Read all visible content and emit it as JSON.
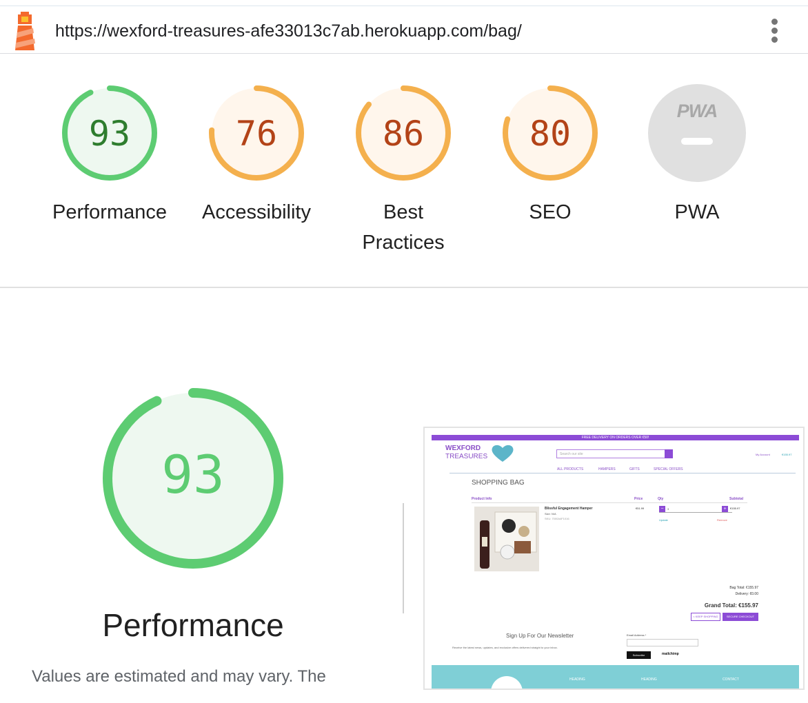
{
  "header": {
    "url": "https://wexford-treasures-afe33013c7ab.herokuapp.com/bag/",
    "logo_icon": "lighthouse-icon",
    "menu_icon": "more-vert-icon"
  },
  "gauges": [
    {
      "label": "Performance",
      "score": "93",
      "value": 93,
      "color": "#5dcc72",
      "text_color": "#2e7d2e",
      "fill": "#eef8f0"
    },
    {
      "label": "Accessibility",
      "score": "76",
      "value": 76,
      "color": "#f4b04d",
      "text_color": "#b34317",
      "fill": "#fff6ec"
    },
    {
      "label": "Best Practices",
      "label_line1": "Best",
      "label_line2": "Practices",
      "score": "86",
      "value": 86,
      "color": "#f4b04d",
      "text_color": "#b34317",
      "fill": "#fff6ec"
    },
    {
      "label": "SEO",
      "score": "80",
      "value": 80,
      "color": "#f4b04d",
      "text_color": "#b34317",
      "fill": "#fff6ec"
    },
    {
      "label": "PWA",
      "badge_text": "PWA",
      "color": "#e0e0e0"
    }
  ],
  "main": {
    "score": "93",
    "value": 93,
    "title": "Performance",
    "description": "Values are estimated and may vary. The"
  },
  "thumbnail": {
    "banner": "FREE DELIVERY ON ORDERS OVER €50!",
    "logo_line1": "WEXFORD",
    "logo_line2": "TREASURES",
    "search_placeholder": "Search our site",
    "account": "My Account",
    "bag_total": "€155.97",
    "nav": [
      "ALL PRODUCTS",
      "HAMPERS",
      "GIFTS",
      "SPECIAL OFFERS"
    ],
    "heading": "SHOPPING BAG",
    "columns": {
      "product": "Product Info",
      "price": "Price",
      "qty": "Qty",
      "subtotal": "Subtotal"
    },
    "item": {
      "name": "Blissful Engagement Hamper",
      "size": "Size: N/A",
      "sku": "SKU: 7000A4F1016",
      "price": "€51.99",
      "qty": "3",
      "subtotal": "€155.97",
      "update": "Update",
      "remove": "Remove"
    },
    "bag_total_label": "Bag Total: €155.97",
    "delivery_label": "Delivery: €0.00",
    "grand_total": "Grand Total: €155.97",
    "keep_shopping": "< KEEP SHOPPING",
    "checkout": "SECURE CHECKOUT",
    "newsletter_title": "Sign Up For Our Newsletter",
    "newsletter_desc": "Receive the latest news, updates, and exclusive offers delivered straight to your inbox.",
    "email_label": "Email Address *",
    "subscribe": "Subscribe",
    "mailchimp": "mailchimp",
    "footer_headings": [
      "HEADING",
      "HEADING",
      "CONTACT"
    ]
  }
}
